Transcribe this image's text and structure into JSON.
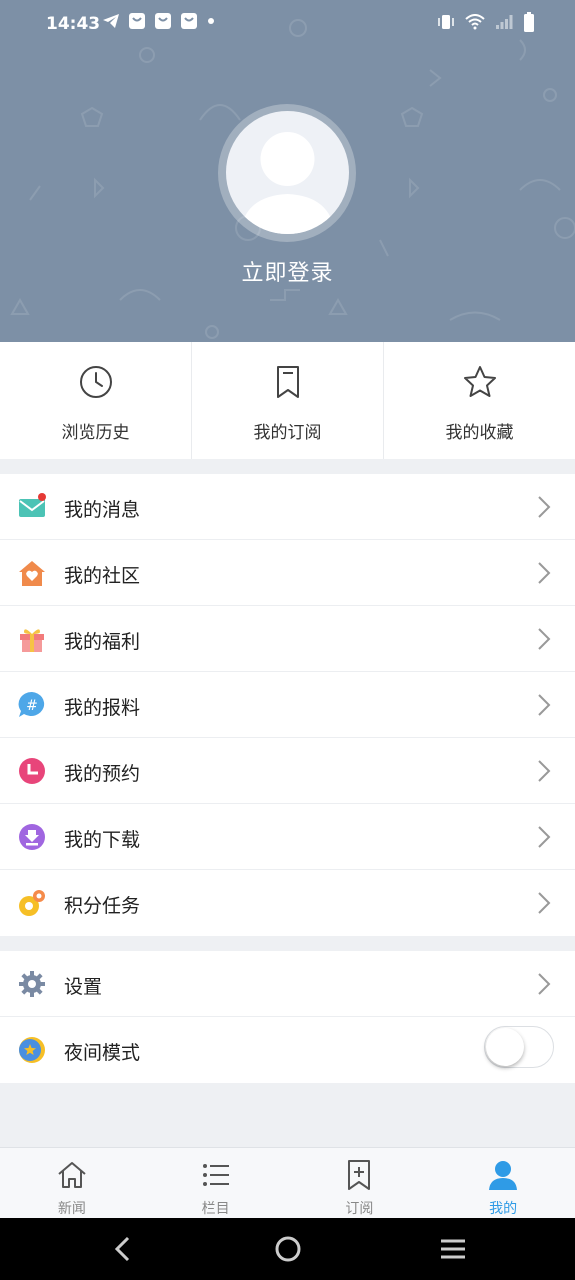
{
  "status_bar": {
    "time": "14:43"
  },
  "profile": {
    "login_label": "立即登录"
  },
  "quick_actions": [
    {
      "label": "浏览历史",
      "icon": "clock-icon"
    },
    {
      "label": "我的订阅",
      "icon": "bookmark-icon"
    },
    {
      "label": "我的收藏",
      "icon": "star-icon"
    }
  ],
  "menu": [
    {
      "label": "我的消息",
      "icon": "mail-icon"
    },
    {
      "label": "我的社区",
      "icon": "house-heart-icon"
    },
    {
      "label": "我的福利",
      "icon": "gift-icon"
    },
    {
      "label": "我的报料",
      "icon": "hash-bubble-icon"
    },
    {
      "label": "我的预约",
      "icon": "clock-pink-icon"
    },
    {
      "label": "我的下载",
      "icon": "download-icon"
    },
    {
      "label": "积分任务",
      "icon": "coin-icon"
    }
  ],
  "settings": [
    {
      "label": "设置",
      "icon": "gear-icon"
    },
    {
      "label": "夜间模式",
      "icon": "night-mode-icon",
      "toggle_on": false
    }
  ],
  "bottom_nav": [
    {
      "label": "新闻",
      "icon": "home-icon",
      "active": false
    },
    {
      "label": "栏目",
      "icon": "list-icon",
      "active": false
    },
    {
      "label": "订阅",
      "icon": "bookmark-add-icon",
      "active": false
    },
    {
      "label": "我的",
      "icon": "person-icon",
      "active": true
    }
  ],
  "colors": {
    "header_bg": "#7d90a6",
    "active_tab": "#2f9be6",
    "notification_dot": "#e53935"
  }
}
